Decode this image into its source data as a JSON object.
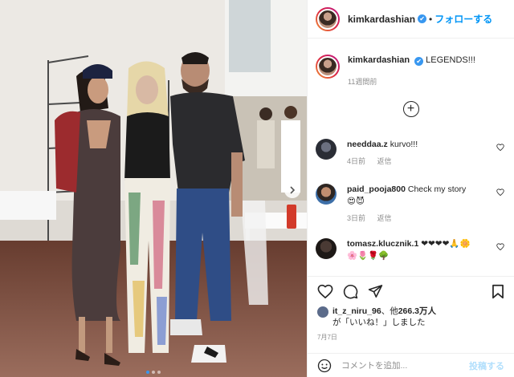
{
  "post": {
    "username": "kimkardashian",
    "follow_label": "フォローする",
    "separator": "•",
    "verified_icon": "✔"
  },
  "caption": {
    "username": "kimkardashian",
    "text": "LEGENDS!!!",
    "time": "11週間前"
  },
  "load_more_icon": "+",
  "comments": [
    {
      "username": "needdaa.z",
      "text": "kurvo!!!",
      "time": "4日前",
      "reply": "返信"
    },
    {
      "username": "paid_pooja800",
      "text": "Check my story",
      "emoji": "😍😈",
      "time": "3日前",
      "reply": "返信"
    },
    {
      "username": "tomasz.klucznik.1",
      "text": "❤❤❤❤🙏🌼",
      "emoji": "🌸🌷🌹🌳"
    }
  ],
  "likes": {
    "user": "it_z_niru_96",
    "others_prefix": "、他",
    "count": "266.3万人",
    "suffix": "が「いいね！」しました"
  },
  "date": "7月7日",
  "composer": {
    "placeholder": "コメントを追加...",
    "post_label": "投稿する"
  },
  "colors": {
    "accent": "#0095f6",
    "verified": "#3897f0",
    "muted": "#8e8e8e"
  }
}
